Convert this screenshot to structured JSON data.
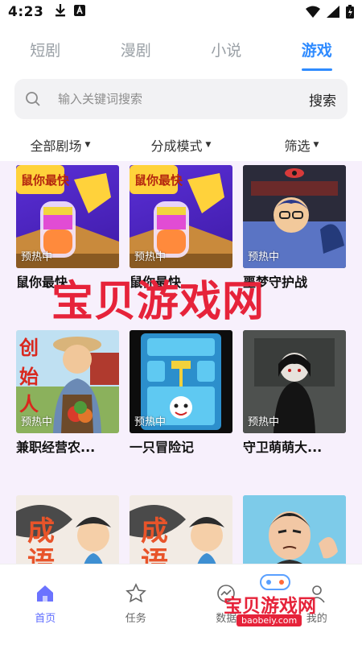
{
  "status": {
    "time": "4:23"
  },
  "tabs": [
    {
      "label": "短剧"
    },
    {
      "label": "漫剧"
    },
    {
      "label": "小说"
    },
    {
      "label": "游戏"
    }
  ],
  "search": {
    "placeholder": "输入关键词搜索",
    "button": "搜索"
  },
  "filters": [
    {
      "label": "全部剧场"
    },
    {
      "label": "分成模式"
    },
    {
      "label": "筛选"
    }
  ],
  "cards": [
    {
      "title": "鼠你最快",
      "badge": "预热中"
    },
    {
      "title": "鼠你最快",
      "badge": "预热中"
    },
    {
      "title": "噩梦守护战",
      "badge": "预热中"
    },
    {
      "title": "兼职经营农...",
      "badge": "预热中"
    },
    {
      "title": "一只冒险记",
      "badge": "预热中"
    },
    {
      "title": "守卫萌萌大...",
      "badge": "预热中"
    },
    {
      "title": "",
      "badge": ""
    },
    {
      "title": "",
      "badge": ""
    },
    {
      "title": "",
      "badge": ""
    }
  ],
  "nav": [
    {
      "label": "首页"
    },
    {
      "label": "任务"
    },
    {
      "label": "数据"
    },
    {
      "label": "我的"
    }
  ],
  "watermark": {
    "text": "宝贝游戏网",
    "small_text": "宝贝游戏网",
    "url": "baobeiy.com"
  }
}
